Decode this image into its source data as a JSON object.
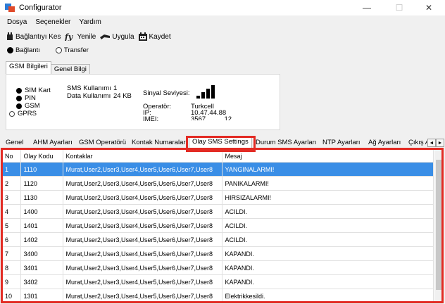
{
  "window": {
    "title": "Configurator",
    "minimize": "—",
    "maximize": "☐",
    "close": "✕"
  },
  "menu": [
    "Dosya",
    "Seçenekler",
    "Yardım"
  ],
  "toolbar": {
    "disconnect": "Bağlantıyı Kes",
    "refresh": "Yenile",
    "apply": "Uygula",
    "save": "Kaydet"
  },
  "mode": {
    "connection": "Bağlantı",
    "transfer": "Transfer"
  },
  "tabs_top": [
    "GSM Bilgileri",
    "Genel Bilgi"
  ],
  "gsm": {
    "sim": "SIM Kart",
    "pin": "PIN",
    "gsm": "GSM",
    "gprs": "GPRS",
    "sms_usage_label": "SMS Kullanımı",
    "sms_usage_value": "1",
    "data_usage_label": "Data Kullanımı",
    "data_usage_value": "24 KB",
    "signal_label": "Sinyal Seviyesi:",
    "signal_level": 4,
    "operator_label": "Operatör:",
    "operator_value": "Turkcell",
    "ip_label": "IP:",
    "ip_value": "10.47.44.88",
    "imei_label": "IMEI:",
    "imei_value": "3567..........12"
  },
  "tabs_settings": [
    "Genel",
    "AHM Ayarları",
    "GSM Operatörü",
    "Kontak Numaraları",
    "Olay SMS Settings",
    "Durum SMS Ayarları",
    "NTP Ayarları",
    "Ağ Ayarları",
    "Çıkış Ay"
  ],
  "tab_scroll": {
    "left": "◄",
    "right": "►"
  },
  "table": {
    "headers": [
      "No",
      "Olay Kodu",
      "Kontaklar",
      "Mesaj"
    ],
    "rows": [
      [
        "1",
        "1110",
        "Murat,User2,User3,User4,User5,User6,User7,User8",
        "YANGINALARMI!"
      ],
      [
        "2",
        "1120",
        "Murat,User2,User3,User4,User5,User6,User7,User8",
        "PANIKALARMI!"
      ],
      [
        "3",
        "1130",
        "Murat,User2,User3,User4,User5,User6,User7,User8",
        "HIRSIZALARMI!"
      ],
      [
        "4",
        "1400",
        "Murat,User2,User3,User4,User5,User6,User7,User8",
        "ACILDI."
      ],
      [
        "5",
        "1401",
        "Murat,User2,User3,User4,User5,User6,User7,User8",
        "ACILDI."
      ],
      [
        "6",
        "1402",
        "Murat,User2,User3,User4,User5,User6,User7,User8",
        "ACILDI."
      ],
      [
        "7",
        "3400",
        "Murat,User2,User3,User4,User5,User6,User7,User8",
        "KAPANDI."
      ],
      [
        "8",
        "3401",
        "Murat,User2,User3,User4,User5,User6,User7,User8",
        "KAPANDI."
      ],
      [
        "9",
        "3402",
        "Murat,User2,User3,User4,User5,User6,User7,User8",
        "KAPANDI."
      ],
      [
        "10",
        "1301",
        "Murat,User2,User3,User4,User5,User6,User7,User8",
        "Elektrikkesildi."
      ]
    ]
  },
  "colors": {
    "highlight": "#e32b24",
    "selected_row": "#3a8ee6"
  }
}
